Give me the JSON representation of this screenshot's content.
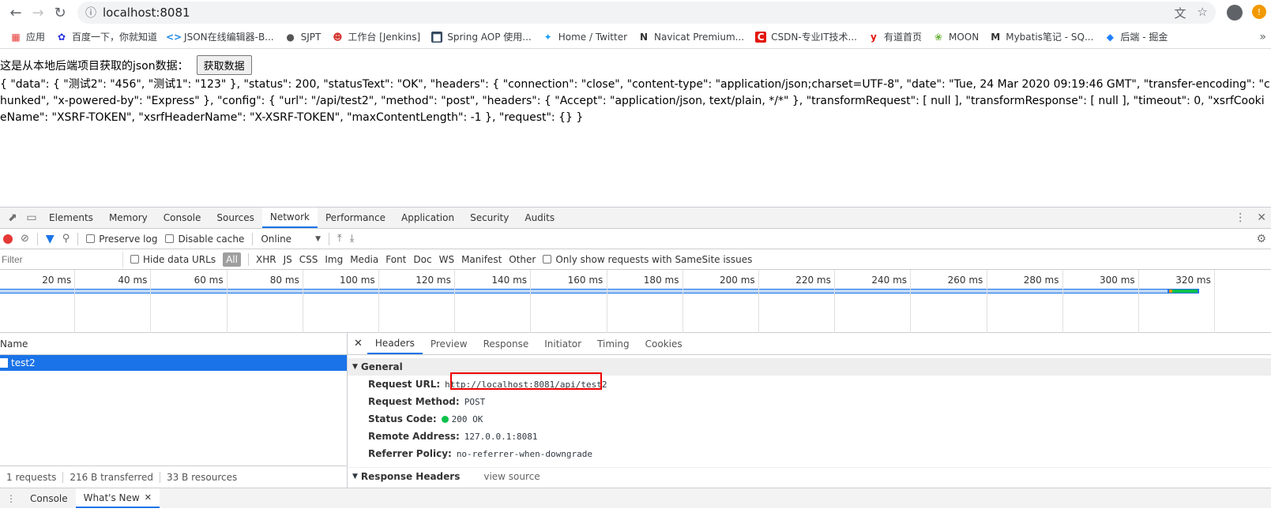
{
  "browser": {
    "url": "localhost:8081"
  },
  "bookmarks": [
    {
      "label": "应用",
      "icon": "apps-grid-icon",
      "color": "#e53935"
    },
    {
      "label": "百度一下，你就知道",
      "icon": "baidu-paw-icon",
      "color": "#2932e1"
    },
    {
      "label": "JSON在线编辑器-B...",
      "icon": "json-icon",
      "color": "#1e88e5"
    },
    {
      "label": "SJPT",
      "icon": "globe-icon",
      "color": "#555555"
    },
    {
      "label": "工作台 [Jenkins]",
      "icon": "jenkins-icon",
      "color": "#d33833"
    },
    {
      "label": "Spring AOP 使用...",
      "icon": "page-icon",
      "color": "#34495e"
    },
    {
      "label": "Home / Twitter",
      "icon": "twitter-bird-icon",
      "color": "#1da1f2"
    },
    {
      "label": "Navicat Premium...",
      "icon": "navicat-icon",
      "color": "#333333"
    },
    {
      "label": "CSDN-专业IT技术...",
      "icon": "csdn-icon",
      "color": "#e3170d"
    },
    {
      "label": "有道首页",
      "icon": "youdao-icon",
      "color": "#e3170d"
    },
    {
      "label": "MOON",
      "icon": "leaf-icon",
      "color": "#6db33f"
    },
    {
      "label": "Mybatis笔记 - SQ...",
      "icon": "mybatis-icon",
      "color": "#333333"
    },
    {
      "label": "后端 - 掘金",
      "icon": "juejin-icon",
      "color": "#1e80ff"
    }
  ],
  "page": {
    "heading": "这是从本地后端项目获取的json数据：",
    "button": "获取数据",
    "json_output": "{ \"data\": { \"测试2\": \"456\", \"测试1\": \"123\" }, \"status\": 200, \"statusText\": \"OK\", \"headers\": { \"connection\": \"close\", \"content-type\": \"application/json;charset=UTF-8\", \"date\": \"Tue, 24 Mar 2020 09:19:46 GMT\", \"transfer-encoding\": \"chunked\", \"x-powered-by\": \"Express\" }, \"config\": { \"url\": \"/api/test2\", \"method\": \"post\", \"headers\": { \"Accept\": \"application/json, text/plain, */*\" }, \"transformRequest\": [ null ], \"transformResponse\": [ null ], \"timeout\": 0, \"xsrfCookieName\": \"XSRF-TOKEN\", \"xsrfHeaderName\": \"X-XSRF-TOKEN\", \"maxContentLength\": -1 }, \"request\": {} }"
  },
  "devtools": {
    "tabs": [
      "Elements",
      "Memory",
      "Console",
      "Sources",
      "Network",
      "Performance",
      "Application",
      "Security",
      "Audits"
    ],
    "active_tab": "Network",
    "toolbar": {
      "preserve_log": "Preserve log",
      "disable_cache": "Disable cache",
      "throttling": "Online"
    },
    "filter": {
      "placeholder": "Filter",
      "hide_data_urls": "Hide data URLs",
      "types": [
        "All",
        "XHR",
        "JS",
        "CSS",
        "Img",
        "Media",
        "Font",
        "Doc",
        "WS",
        "Manifest",
        "Other"
      ],
      "same_site": "Only show requests with SameSite issues"
    },
    "timeline_ticks": [
      "20 ms",
      "40 ms",
      "60 ms",
      "80 ms",
      "100 ms",
      "120 ms",
      "140 ms",
      "160 ms",
      "180 ms",
      "200 ms",
      "220 ms",
      "240 ms",
      "260 ms",
      "280 ms",
      "300 ms",
      "320 ms"
    ],
    "request_list": {
      "header": "Name",
      "requests": [
        "test2"
      ],
      "footer": [
        "1 requests",
        "216 B transferred",
        "33 B resources"
      ]
    },
    "details": {
      "tabs": [
        "Headers",
        "Preview",
        "Response",
        "Initiator",
        "Timing",
        "Cookies"
      ],
      "general_title": "General",
      "request_url_label": "Request URL:",
      "request_url_scheme": "http:",
      "request_url_rest": "//localhost:8081/api/test2",
      "request_method_label": "Request Method:",
      "request_method": "POST",
      "status_code_label": "Status Code:",
      "status_code": "200 OK",
      "remote_address_label": "Remote Address:",
      "remote_address": "127.0.0.1:8081",
      "referrer_policy_label": "Referrer Policy:",
      "referrer_policy": "no-referrer-when-downgrade",
      "response_headers_title": "Response Headers",
      "view_source": "view source"
    },
    "drawer_tabs": [
      "Console",
      "What's New"
    ]
  }
}
